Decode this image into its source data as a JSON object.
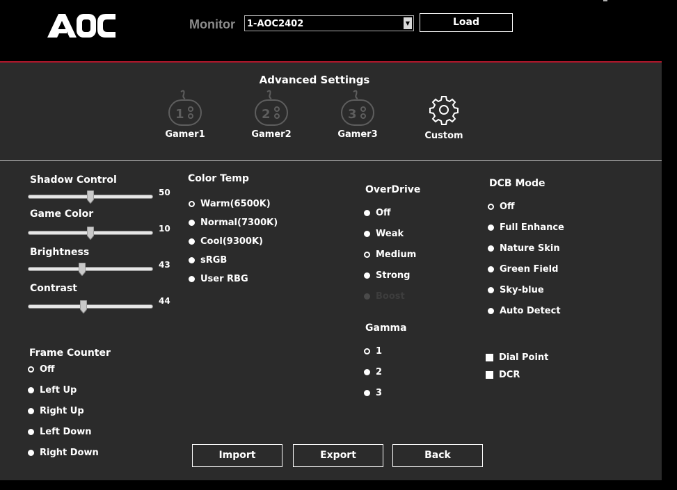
{
  "header": {
    "logo_text": "AOC",
    "monitor_label": "Monitor",
    "monitor_value": "1-AOC2402",
    "load_label": "Load"
  },
  "advanced": {
    "title": "Advanced Settings",
    "presets": [
      {
        "label": "Gamer1",
        "icon": "gamepad-1-icon"
      },
      {
        "label": "Gamer2",
        "icon": "gamepad-2-icon"
      },
      {
        "label": "Gamer3",
        "icon": "gamepad-3-icon"
      },
      {
        "label": "Custom",
        "icon": "gear-icon"
      }
    ]
  },
  "sliders": [
    {
      "label": "Shadow Control",
      "value": "50",
      "level": 50
    },
    {
      "label": "Game Color",
      "value": "10",
      "level": 50
    },
    {
      "label": "Brightness",
      "value": "43",
      "level": 43
    },
    {
      "label": "Contrast",
      "value": "44",
      "level": 44
    }
  ],
  "color_temp": {
    "title": "Color Temp",
    "options": [
      "Warm(6500K)",
      "Normal(7300K)",
      "Cool(9300K)",
      "sRGB",
      "User RBG"
    ],
    "selected": "Warm(6500K)"
  },
  "overdrive": {
    "title": "OverDrive",
    "options": [
      "Off",
      "Weak",
      "Medium",
      "Strong",
      "Boost"
    ],
    "selected": "Medium",
    "disabled": [
      "Boost"
    ]
  },
  "gamma": {
    "title": "Gamma",
    "options": [
      "1",
      "2",
      "3"
    ],
    "selected": "1"
  },
  "dcb_mode": {
    "title": "DCB Mode",
    "options": [
      "Off",
      "Full Enhance",
      "Nature Skin",
      "Green Field",
      "Sky-blue",
      "Auto Detect"
    ],
    "selected": "Off"
  },
  "checkboxes": [
    "Dial Point",
    "DCR"
  ],
  "frame_counter": {
    "title": "Frame Counter",
    "options": [
      "Off",
      "Left Up",
      "Right Up",
      "Left Down",
      "Right Down"
    ],
    "selected": "Off"
  },
  "buttons": {
    "import_label": "Import",
    "export_label": "Export",
    "back_label": "Back"
  },
  "colors": {
    "accent_line": "#b0162b",
    "panel_bg": "#2b2b2b",
    "header_bg": "#000000"
  }
}
